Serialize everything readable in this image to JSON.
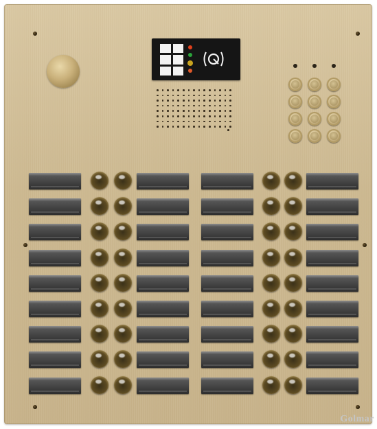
{
  "panel": {
    "type": "intercom-door-panel",
    "finish": "brushed-brass",
    "accent_color": "#cdb991",
    "name_slots_per_column": 9,
    "columns": 4,
    "call_buttons_per_row": 4,
    "keypad": {
      "rows": 4,
      "cols": 3,
      "indicator_leds": 3
    },
    "display": {
      "grid_icon": "call-grid-icon",
      "status_leds": [
        "#e0401c",
        "#2aa33a",
        "#c9a41f",
        "#e05a2a"
      ],
      "rfid_icon": "rfid-reader-icon"
    }
  },
  "brand": {
    "text": "Golmar"
  }
}
